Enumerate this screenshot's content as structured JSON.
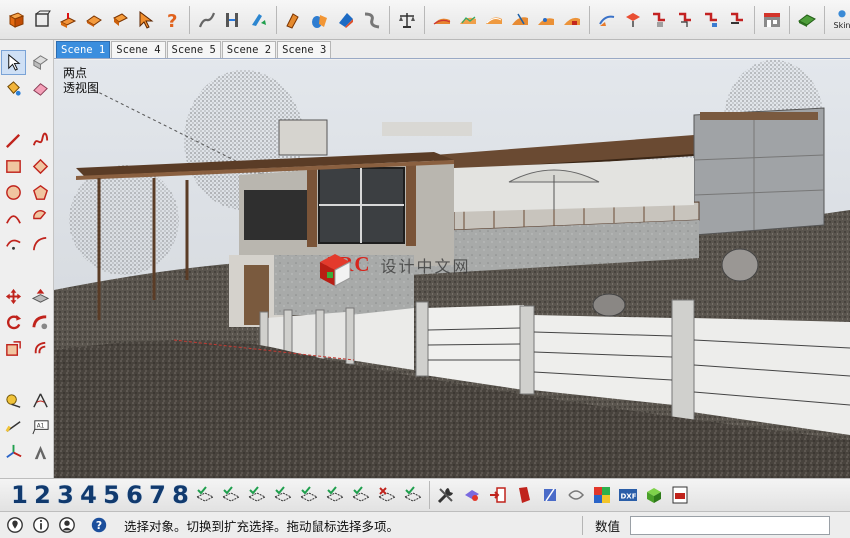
{
  "app": {
    "accent_tab_color": "#3b8ede",
    "status_text": "选择对象。切换到扩充选择。拖动鼠标选择多项。",
    "measurements_label": "数值",
    "measurements_value": ""
  },
  "top_toolbar": {
    "skin_label": "Skin",
    "icons": [
      "new-file-icon",
      "open-file-icon",
      "cube-icon",
      "eraser-icon",
      "paint-icon",
      "pointer-icon",
      "help-icon",
      "line-icon",
      "measure-icon",
      "tape-icon",
      "section-icon",
      "shapes-icon",
      "material-icon",
      "scale-icon",
      "terrain-icon",
      "sandbox-icon",
      "road-icon",
      "roof-icon",
      "stair-icon",
      "path-icon",
      "arc-icon",
      "pipe-icon",
      "spline-icon",
      "solid-icon",
      "camera-icon",
      "warehouse-icon",
      "extension-icon",
      "skin-icon"
    ]
  },
  "scene_tabs": [
    {
      "label": "Scene 1",
      "active": true
    },
    {
      "label": "Scene 4",
      "active": false
    },
    {
      "label": "Scene 5",
      "active": false
    },
    {
      "label": "Scene 2",
      "active": false
    },
    {
      "label": "Scene 3",
      "active": false
    }
  ],
  "viewport": {
    "camera_line1": "两点",
    "camera_line2": "透视图",
    "watermark_logo": "ARC",
    "watermark_text": "设计中文网"
  },
  "bottom_toolbar": {
    "views": [
      "1",
      "2",
      "3",
      "4",
      "5",
      "6",
      "7",
      "8"
    ]
  },
  "left_toolbar": {
    "icons": [
      "select-icon",
      "component-icon",
      "paint-bucket-icon",
      "eraser-icon",
      "pencil-icon",
      "freehand-icon",
      "rectangle-icon",
      "rotated-rectangle-icon",
      "circle-icon",
      "polygon-icon",
      "arc-icon",
      "pie-icon",
      "arc3-icon",
      "arc2-icon",
      "move-icon",
      "push-pull-icon",
      "rotate-icon",
      "follow-me-icon",
      "scale-icon",
      "offset-icon",
      "tape-measure-icon",
      "protractor-icon",
      "dimension-icon",
      "text-icon",
      "axes-icon",
      "3d-text-icon",
      "orbit-icon",
      "pan-icon",
      "zoom-icon",
      "zoom-window-icon"
    ]
  }
}
